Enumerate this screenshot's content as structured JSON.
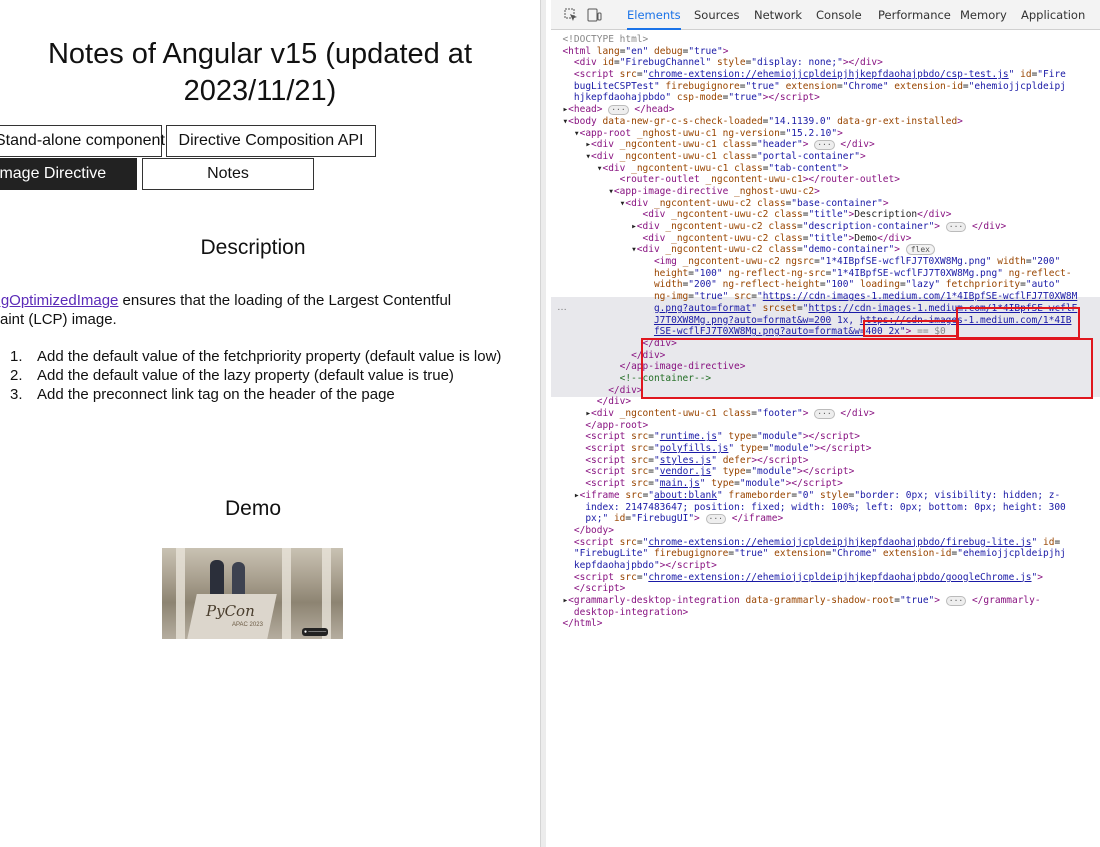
{
  "page": {
    "title": "Notes of Angular v15 (updated at 2023/11/21)",
    "tabs": [
      {
        "label": "Stand-alone component",
        "active": false
      },
      {
        "label": "Directive Composition API",
        "active": false
      },
      {
        "label": "Image Directive",
        "active": true
      },
      {
        "label": "Notes",
        "active": false
      }
    ],
    "description_title": "Description",
    "description_link": "NgOptimizedImage",
    "description_text": " ensures that the loading of the Largest Contentful Paint (LCP) image.",
    "steps": [
      "Add the default value of the fetchpriority property (default value is low)",
      "Add the default value of the lazy property (default value is true)",
      "Add the preconnect link tag on the header of the page"
    ],
    "demo_title": "Demo",
    "demo_image": {
      "logo_text": "PyCon",
      "sub_text": "APAC 2023"
    }
  },
  "devtools": {
    "tabs": [
      "Elements",
      "Sources",
      "Network",
      "Console",
      "Performance",
      "Memory",
      "Application"
    ],
    "active_tab": "Elements",
    "icons": {
      "inspect": "inspect-icon",
      "device": "device-toggle-icon"
    },
    "highlight_color": "#e0161e"
  }
}
